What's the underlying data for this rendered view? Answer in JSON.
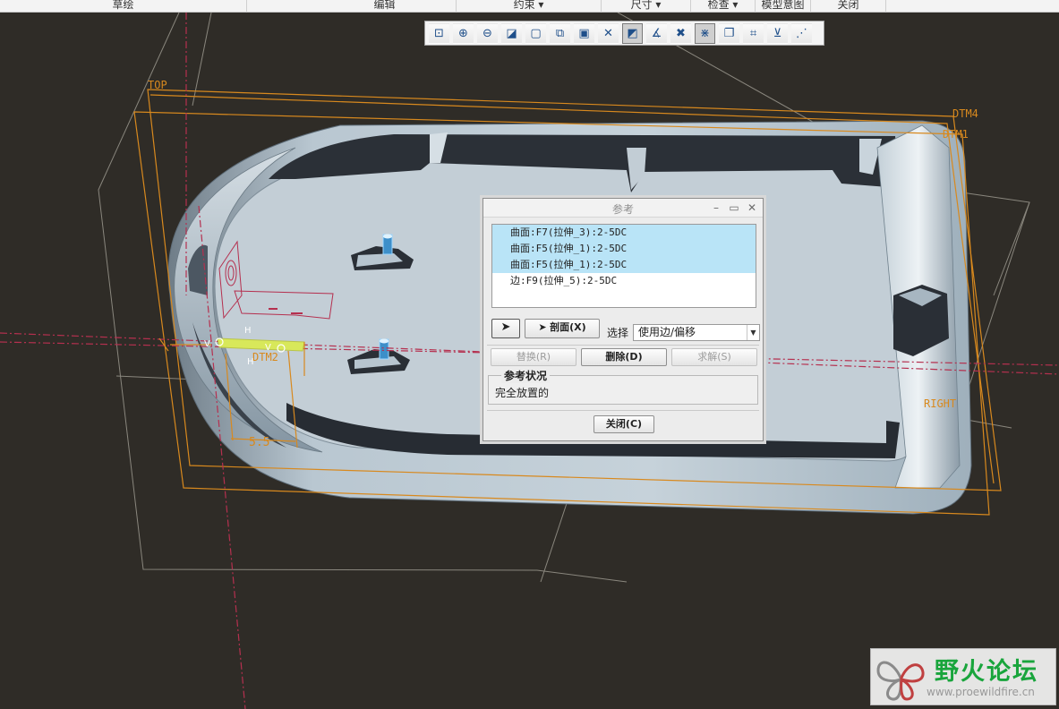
{
  "menu": {
    "items": [
      {
        "label": "草绘"
      },
      {
        "label": "编辑"
      },
      {
        "label": "约束 ▾"
      },
      {
        "label": "尺寸 ▾"
      },
      {
        "label": "检查 ▾"
      },
      {
        "label": "模型意图"
      },
      {
        "label": "关闭"
      }
    ]
  },
  "toolbar": {
    "icons": [
      "refit-icon",
      "zoom-in-icon",
      "zoom-out-icon",
      "repaint-icon",
      "shading-icon",
      "saved-views-icon",
      "camera-icon",
      "dimension-display-icon",
      "constraint-display-icon",
      "sketch-orientation-icon",
      "vertex-display-icon",
      "grid-display-icon",
      "layer-icon",
      "annotation-display-icon",
      "spin-center-icon",
      "datum-point-icon"
    ]
  },
  "scene": {
    "datum_labels": {
      "top": "TOP",
      "dtm4": "DTM4",
      "dtm1": "DTM1",
      "dtm2": "DTM2",
      "right": "RIGHT"
    },
    "dimension": "5.5",
    "sketch_marks": {
      "v": "V",
      "h": "H"
    },
    "colors": {
      "background": "#2f2c27",
      "part_body": "#aebdc7",
      "part_dark": "#2a2f36",
      "datum_orange": "#d8891e",
      "centerline": "#b5304f",
      "sketch_highlight": "#d8e85a"
    }
  },
  "dialog": {
    "title": "参考",
    "references": [
      {
        "text": "曲面:F7(拉伸_3):2-5DC",
        "selected": true
      },
      {
        "text": "曲面:F5(拉伸_1):2-5DC",
        "selected": true
      },
      {
        "text": "曲面:F5(拉伸_1):2-5DC",
        "selected": true
      },
      {
        "text": "边:F9(拉伸_5):2-5DC",
        "selected": false
      }
    ],
    "xsec_button": "剖面(X)",
    "select_label": "选择",
    "select_value": "使用边/偏移",
    "replace_button": "替换(R)",
    "delete_button": "删除(D)",
    "solve_button": "求解(S)",
    "status_legend": "参考状况",
    "status_text": "完全放置的",
    "close_button": "关闭(C)"
  },
  "watermark": {
    "title": "野火论坛",
    "url": "www.proewildfire.cn"
  }
}
